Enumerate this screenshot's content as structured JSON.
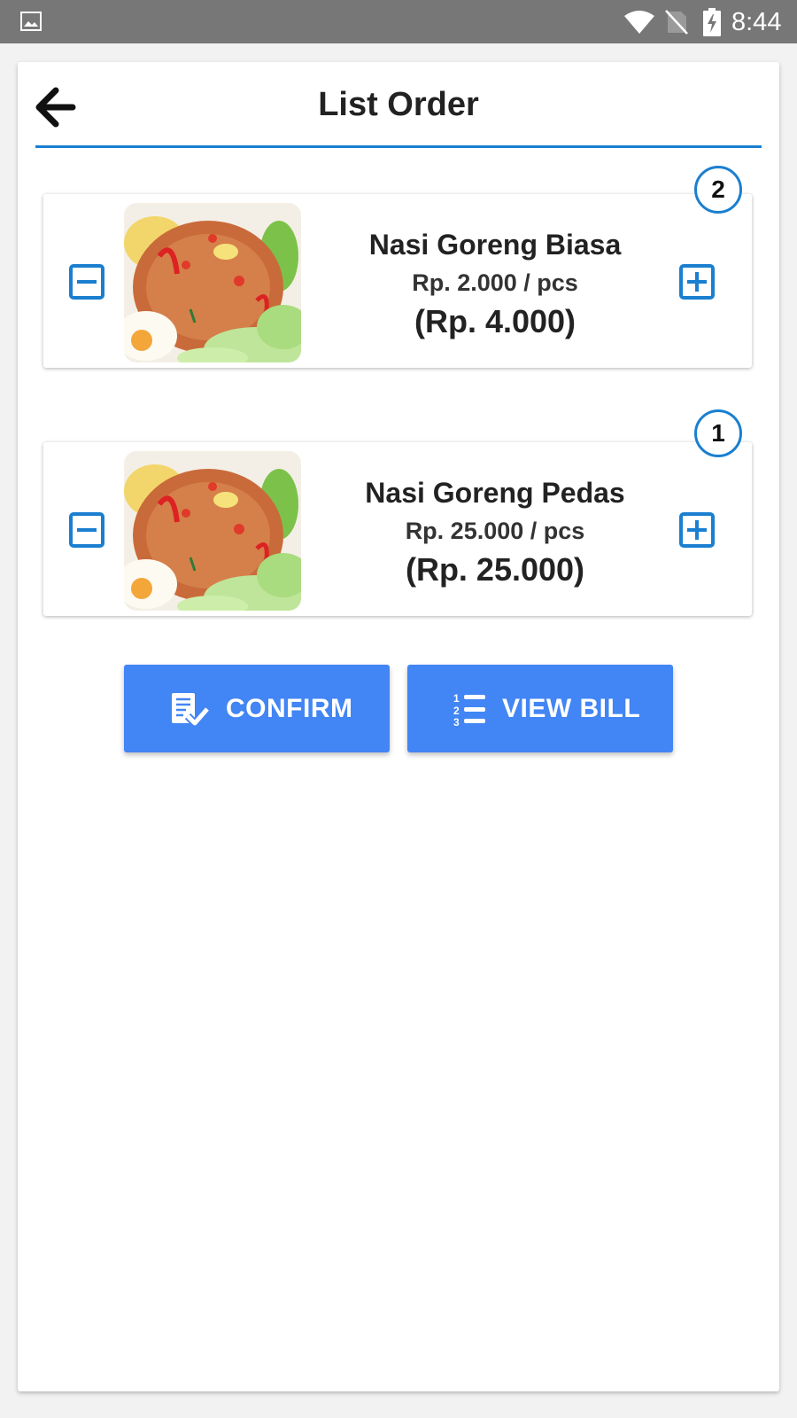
{
  "status_bar": {
    "time": "8:44",
    "icons": [
      "image-notification-icon",
      "wifi-icon",
      "no-sim-icon",
      "battery-charging-icon"
    ]
  },
  "header": {
    "title": "List Order",
    "back_icon": "arrow-left-icon"
  },
  "colors": {
    "accent": "#1a7fd0",
    "button": "#4285f4",
    "status_bar": "#777777"
  },
  "orders": [
    {
      "name": "Nasi Goreng Biasa",
      "unit_price": "Rp. 2.000 / pcs",
      "subtotal": "(Rp. 4.000)",
      "quantity": "2",
      "image": "fried-rice-photo"
    },
    {
      "name": "Nasi Goreng Pedas",
      "unit_price": "Rp. 25.000 / pcs",
      "subtotal": "(Rp. 25.000)",
      "quantity": "1",
      "image": "fried-rice-photo"
    }
  ],
  "actions": {
    "confirm_label": "CONFIRM",
    "confirm_icon": "checklist-icon",
    "view_bill_label": "VIEW BILL",
    "view_bill_icon": "numbered-list-icon"
  }
}
